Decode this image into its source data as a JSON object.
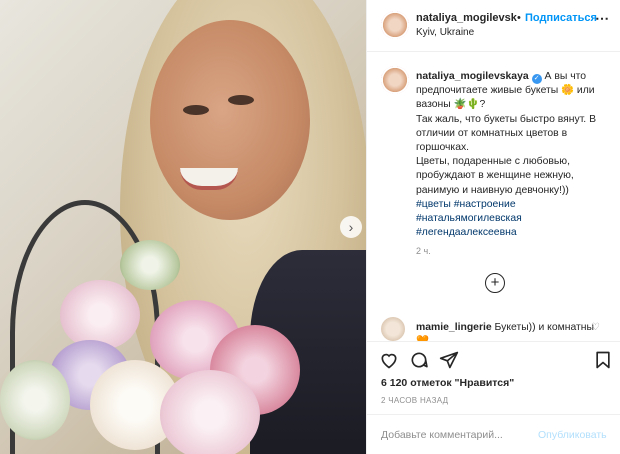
{
  "header": {
    "username": "nataliya_mogilevsk",
    "separator": "•",
    "follow_label": "Подписаться",
    "location": "Kyiv, Ukraine",
    "more_icon": "⋯"
  },
  "caption": {
    "username": "nataliya_mogilevskaya",
    "verified_icon": "✓",
    "line1": " А вы что предпочитаете живые букеты 🌼 или вазоны 🪴🌵?",
    "line2": "Так жаль, что букеты быстро вянут. В отличии от комнатных цветов в горшочках.",
    "line3": "Цветы, подаренные с любовью, пробуждают в женщине нежную, ранимую и наивную девчонку!))",
    "tags": [
      "#цветы",
      "#настроение",
      "#натальямогилевская",
      "#легендаалексеевна"
    ],
    "time": "2 ч."
  },
  "load_more_icon": "+",
  "comment": {
    "username": "mamie_lingerie",
    "text": " Букеты)) и комнатны 🧡",
    "like_icon": "♡"
  },
  "actions": {
    "icons": [
      "heart-icon",
      "comment-icon",
      "share-icon",
      "bookmark-icon"
    ]
  },
  "likes": "6 120 отметок \"Нравится\"",
  "time_ago": "2 ЧАСОВ НАЗАД",
  "comment_box": {
    "placeholder": "Добавьте комментарий...",
    "publish_label": "Опубликовать"
  },
  "photo": {
    "next_icon": "›"
  },
  "colors": {
    "accent": "#0095f6",
    "publish_disabled": "#b2dffc",
    "hashtag": "#00376b"
  }
}
